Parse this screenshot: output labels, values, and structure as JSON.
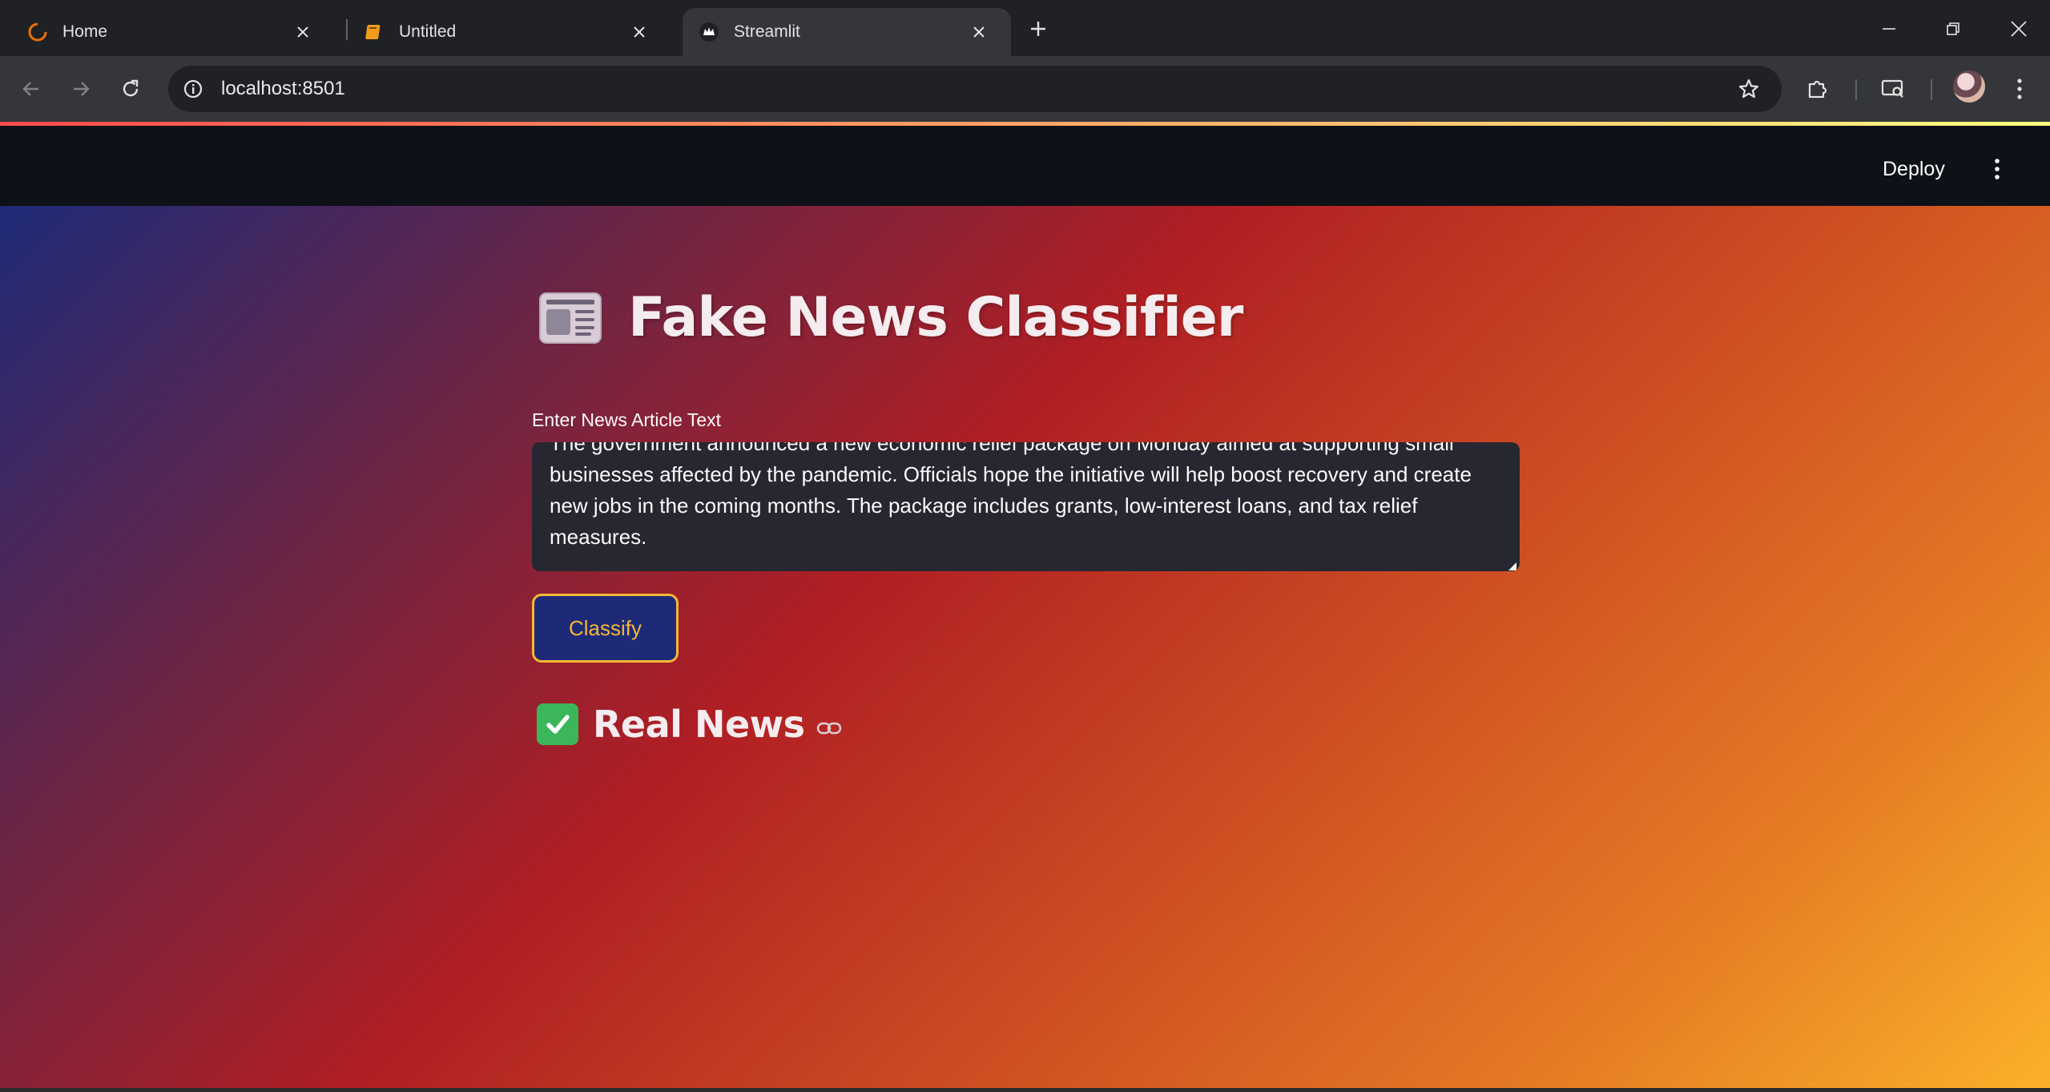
{
  "browser": {
    "tabs": [
      {
        "title": "Home",
        "icon": "loading-ring-icon",
        "active": false
      },
      {
        "title": "Untitled",
        "icon": "notebook-icon",
        "active": false
      },
      {
        "title": "Streamlit",
        "icon": "streamlit-crown-icon",
        "active": true
      }
    ],
    "url": "localhost:8501"
  },
  "app_header": {
    "deploy_label": "Deploy"
  },
  "app": {
    "title": "Fake News Classifier",
    "title_icon": "newspaper-icon",
    "input_label": "Enter News Article Text",
    "input_value": "The government announced a new economic relief package on Monday aimed at supporting small businesses affected by the pandemic. Officials hope the initiative will help boost recovery and create new jobs in the coming months. The package includes grants, low-interest loans, and tax relief measures.",
    "classify_label": "Classify",
    "result_text": "Real News",
    "result_icon": "check-mark-icon"
  },
  "colors": {
    "accent": "#f5b833",
    "button_bg": "#1e2a78",
    "header_bg": "#0e1117",
    "textarea_bg": "#262730",
    "gradient_start": "#1e2a78",
    "gradient_mid": "#b01e23",
    "gradient_end": "#fbb12a"
  }
}
